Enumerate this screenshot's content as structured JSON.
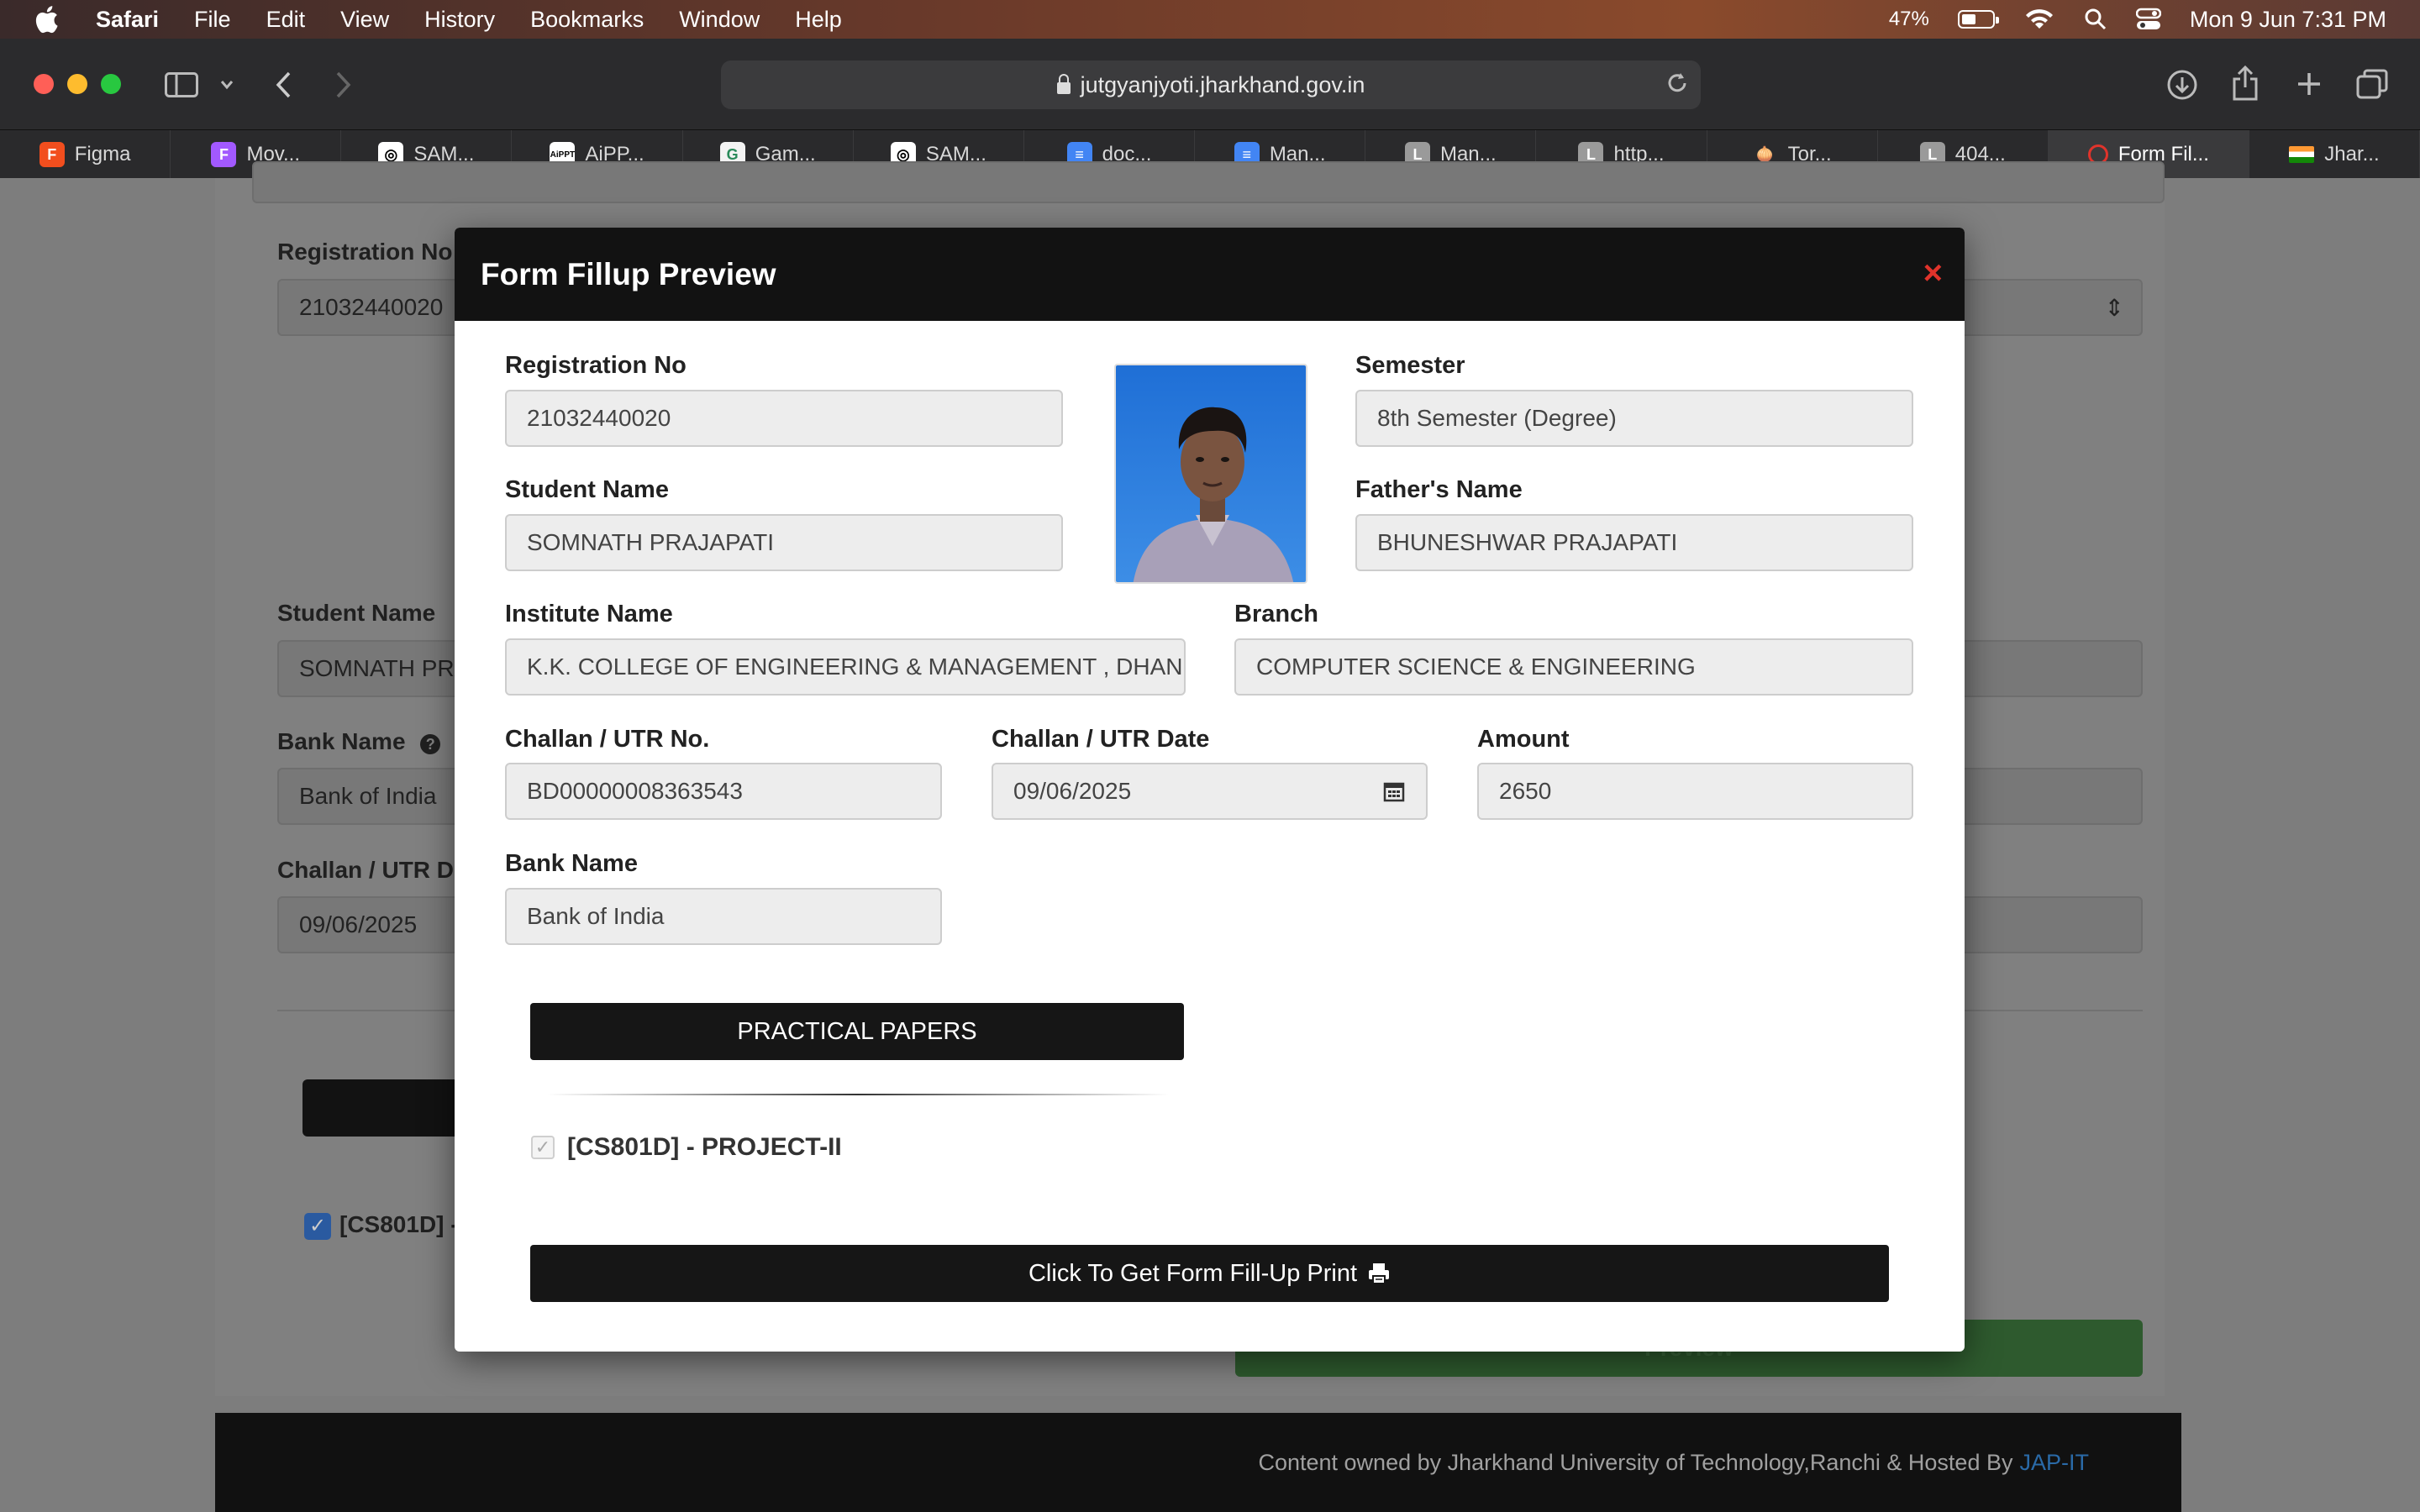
{
  "menubar": {
    "app": "Safari",
    "items": [
      "File",
      "Edit",
      "View",
      "History",
      "Bookmarks",
      "Window",
      "Help"
    ],
    "battery": "47%",
    "clock": "Mon 9 Jun  7:31 PM"
  },
  "browser": {
    "url": "jutgyanjyoti.jharkhand.gov.in",
    "tabs": [
      {
        "label": "Figma",
        "icon": "figma-icon",
        "color": "#f24e1e"
      },
      {
        "label": "Mov...",
        "icon": "figma-icon",
        "color": "#a259ff"
      },
      {
        "label": "SAM...",
        "icon": "openai-icon",
        "color": "#fff"
      },
      {
        "label": "AiPP...",
        "icon": "aippt-icon",
        "color": "#fff"
      },
      {
        "label": "Gam...",
        "icon": "gamma-icon",
        "color": "#f3f3f3"
      },
      {
        "label": "SAM...",
        "icon": "openai-icon",
        "color": "#fff"
      },
      {
        "label": "doc...",
        "icon": "docs-icon",
        "color": "#4285f4"
      },
      {
        "label": "Man...",
        "icon": "docs-icon",
        "color": "#4285f4"
      },
      {
        "label": "Man...",
        "icon": "letter-l-icon",
        "color": "#9a9a9a"
      },
      {
        "label": "http...",
        "icon": "letter-l-icon",
        "color": "#9a9a9a"
      },
      {
        "label": "Tor...",
        "icon": "tor-icon",
        "color": "#7d4698"
      },
      {
        "label": "404...",
        "icon": "letter-l-icon",
        "color": "#9a9a9a"
      },
      {
        "label": "Form Fil...",
        "icon": "site-logo-icon",
        "color": "#e0332b",
        "active": true
      },
      {
        "label": "Jhar...",
        "icon": "flag-icon",
        "color": "#ff9933"
      }
    ]
  },
  "background_page": {
    "registration_label": "Registration No",
    "registration_value": "21032440020",
    "student_name_label": "Student Name",
    "student_name_value": "SOMNATH PRA",
    "bank_name_label": "Bank Name",
    "bank_name_value": "Bank of India",
    "challan_label": "Challan / UTR D",
    "challan_value": "09/06/2025",
    "paper_checkbox_label": "[CS801D] -",
    "preview_button": "Preview"
  },
  "footer": {
    "text": "Content owned by Jharkhand University of Technology,Ranchi & Hosted By",
    "link": "JAP-IT"
  },
  "modal": {
    "title": "Form Fillup Preview",
    "close": "×",
    "fields": {
      "registration_no": {
        "label": "Registration No",
        "value": "21032440020"
      },
      "semester": {
        "label": "Semester",
        "value": "8th Semester (Degree)"
      },
      "student_name": {
        "label": "Student Name",
        "value": "SOMNATH PRAJAPATI"
      },
      "fathers_name": {
        "label": "Father's Name",
        "value": "BHUNESHWAR PRAJAPATI"
      },
      "institute_name": {
        "label": "Institute Name",
        "value": "K.K. COLLEGE OF ENGINEERING & MANAGEMENT , DHANBAD"
      },
      "branch": {
        "label": "Branch",
        "value": "COMPUTER SCIENCE & ENGINEERING"
      },
      "challan_no": {
        "label": "Challan / UTR No.",
        "value": "BD00000008363543"
      },
      "challan_date": {
        "label": "Challan / UTR Date",
        "value": "09/06/2025"
      },
      "amount": {
        "label": "Amount",
        "value": "2650"
      },
      "bank_name": {
        "label": "Bank Name",
        "value": "Bank of India"
      }
    },
    "practical_papers_button": "PRACTICAL PAPERS",
    "paper": {
      "label": "[CS801D] - PROJECT-II",
      "checked": true
    },
    "print_button": "Click To Get Form Fill-Up Print"
  }
}
